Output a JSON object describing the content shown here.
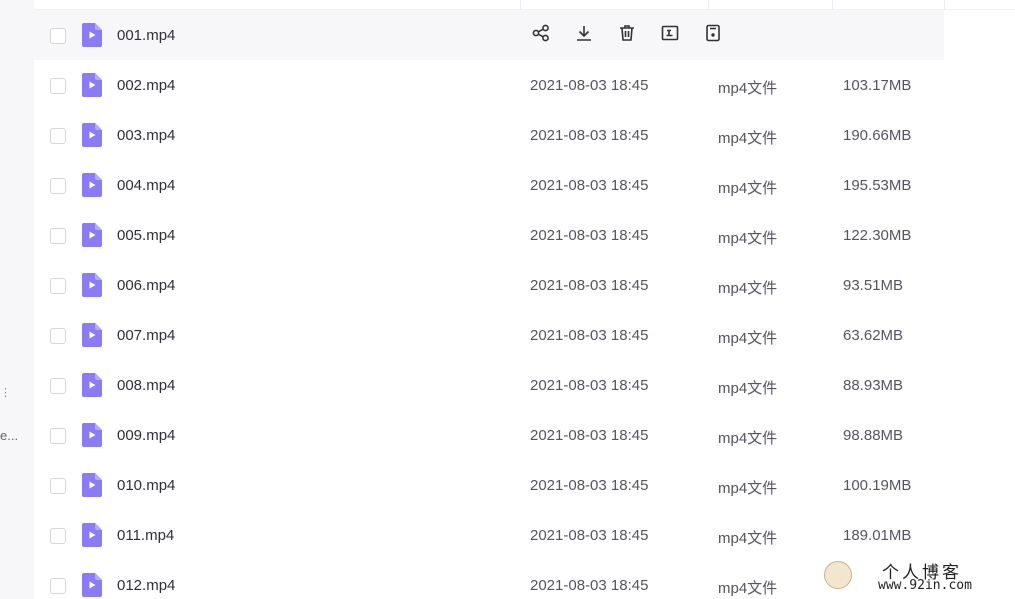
{
  "sidebar": {
    "dots": "⋮",
    "ellipsis": "e..."
  },
  "files": [
    {
      "name": "001.mp4",
      "date": "",
      "type": "",
      "size": "",
      "hover": true
    },
    {
      "name": "002.mp4",
      "date": "2021-08-03 18:45",
      "type": "mp4文件",
      "size": "103.17MB"
    },
    {
      "name": "003.mp4",
      "date": "2021-08-03 18:45",
      "type": "mp4文件",
      "size": "190.66MB"
    },
    {
      "name": "004.mp4",
      "date": "2021-08-03 18:45",
      "type": "mp4文件",
      "size": "195.53MB"
    },
    {
      "name": "005.mp4",
      "date": "2021-08-03 18:45",
      "type": "mp4文件",
      "size": "122.30MB"
    },
    {
      "name": "006.mp4",
      "date": "2021-08-03 18:45",
      "type": "mp4文件",
      "size": "93.51MB"
    },
    {
      "name": "007.mp4",
      "date": "2021-08-03 18:45",
      "type": "mp4文件",
      "size": "63.62MB"
    },
    {
      "name": "008.mp4",
      "date": "2021-08-03 18:45",
      "type": "mp4文件",
      "size": "88.93MB"
    },
    {
      "name": "009.mp4",
      "date": "2021-08-03 18:45",
      "type": "mp4文件",
      "size": "98.88MB"
    },
    {
      "name": "010.mp4",
      "date": "2021-08-03 18:45",
      "type": "mp4文件",
      "size": "100.19MB"
    },
    {
      "name": "011.mp4",
      "date": "2021-08-03 18:45",
      "type": "mp4文件",
      "size": "189.01MB"
    },
    {
      "name": "012.mp4",
      "date": "2021-08-03 18:45",
      "type": "mp4文件",
      "size": ""
    }
  ],
  "hover_actions": [
    {
      "icon": "share-icon"
    },
    {
      "icon": "download-icon"
    },
    {
      "icon": "delete-icon"
    },
    {
      "icon": "rename-icon"
    },
    {
      "icon": "more-file-icon"
    }
  ],
  "watermark": {
    "title": "个人博客",
    "url": "www.92in.com"
  },
  "colors": {
    "file_icon": "#8b7cf6",
    "hover_row": "#f7f7fa",
    "text": "#2f2f38",
    "muted": "#555560"
  }
}
